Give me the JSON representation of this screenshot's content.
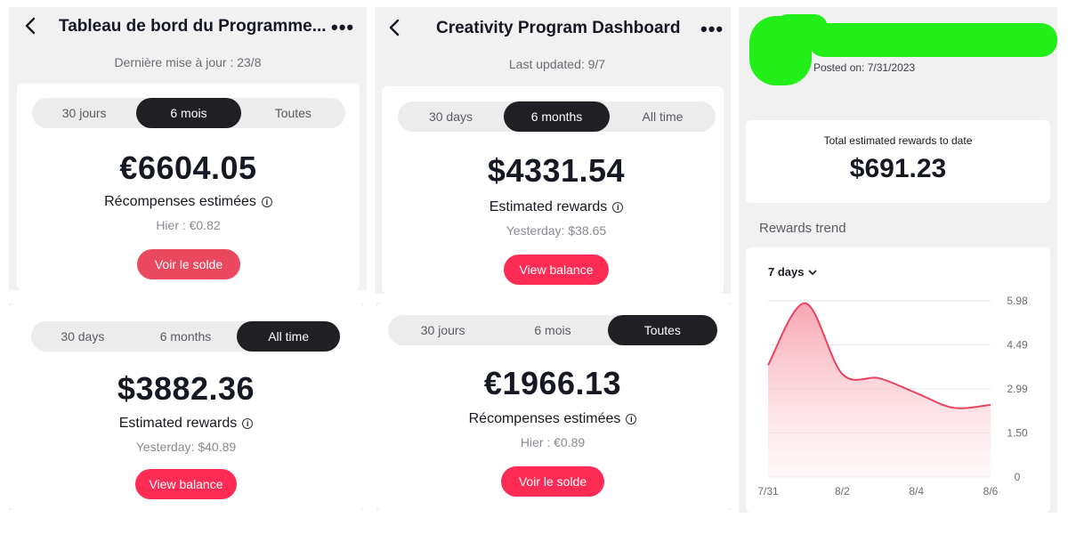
{
  "panel_fr_6mois": {
    "title": "Tableau de bord du Programme...",
    "menu_glyph": "•••",
    "updated": "Dernière mise à jour : 23/8",
    "tabs": [
      {
        "label": "30 jours",
        "active": false
      },
      {
        "label": "6 mois",
        "active": true
      },
      {
        "label": "Toutes",
        "active": false
      }
    ],
    "amount": "€6604.05",
    "rewards_label": "Récompenses estimées",
    "yesterday": "Hier : €0.82",
    "button": "Voir le solde"
  },
  "panel_en_6months": {
    "title": "Creativity Program Dashboard",
    "menu_glyph": "•••",
    "updated": "Last updated: 9/7",
    "tabs": [
      {
        "label": "30 days",
        "active": false
      },
      {
        "label": "6 months",
        "active": true
      },
      {
        "label": "All time",
        "active": false
      }
    ],
    "amount": "$4331.54",
    "rewards_label": "Estimated rewards",
    "yesterday": "Yesterday: $38.65",
    "button": "View balance"
  },
  "panel_en_alltime": {
    "tabs": [
      {
        "label": "30 days",
        "active": false
      },
      {
        "label": "6 months",
        "active": false
      },
      {
        "label": "All time",
        "active": true
      }
    ],
    "amount": "$3882.36",
    "rewards_label": "Estimated rewards",
    "yesterday": "Yesterday: $40.89",
    "button": "View balance"
  },
  "panel_fr_toutes": {
    "tabs": [
      {
        "label": "30 jours",
        "active": false
      },
      {
        "label": "6 mois",
        "active": false
      },
      {
        "label": "Toutes",
        "active": true
      }
    ],
    "amount": "€1966.13",
    "rewards_label": "Récompenses estimées",
    "yesterday": "Hier : €0.89",
    "button": "Voir le solde"
  },
  "panel_trend": {
    "posted": "Posted on: 7/31/2023",
    "total_label": "Total estimated rewards to date",
    "total_amount": "$691.23",
    "trend_title": "Rewards trend",
    "range": "7 days",
    "colors": {
      "line": "#e8435f",
      "fill_top": "#f7a5b1",
      "fill_bottom": "#fdecef",
      "grid": "#e6e6e6",
      "redaction": "#22ee18"
    }
  },
  "chart_data": {
    "type": "area",
    "x": [
      "7/31",
      "8/1",
      "8/2",
      "8/3",
      "8/4",
      "8/5",
      "8/6"
    ],
    "values": [
      3.8,
      5.9,
      3.5,
      3.35,
      2.85,
      2.35,
      2.45
    ],
    "xticks": [
      "7/31",
      "8/2",
      "8/4",
      "8/6"
    ],
    "yticks": [
      "5.98",
      "4.49",
      "2.99",
      "1.50",
      "0"
    ],
    "ylim": [
      0,
      5.98
    ],
    "grid": true
  }
}
